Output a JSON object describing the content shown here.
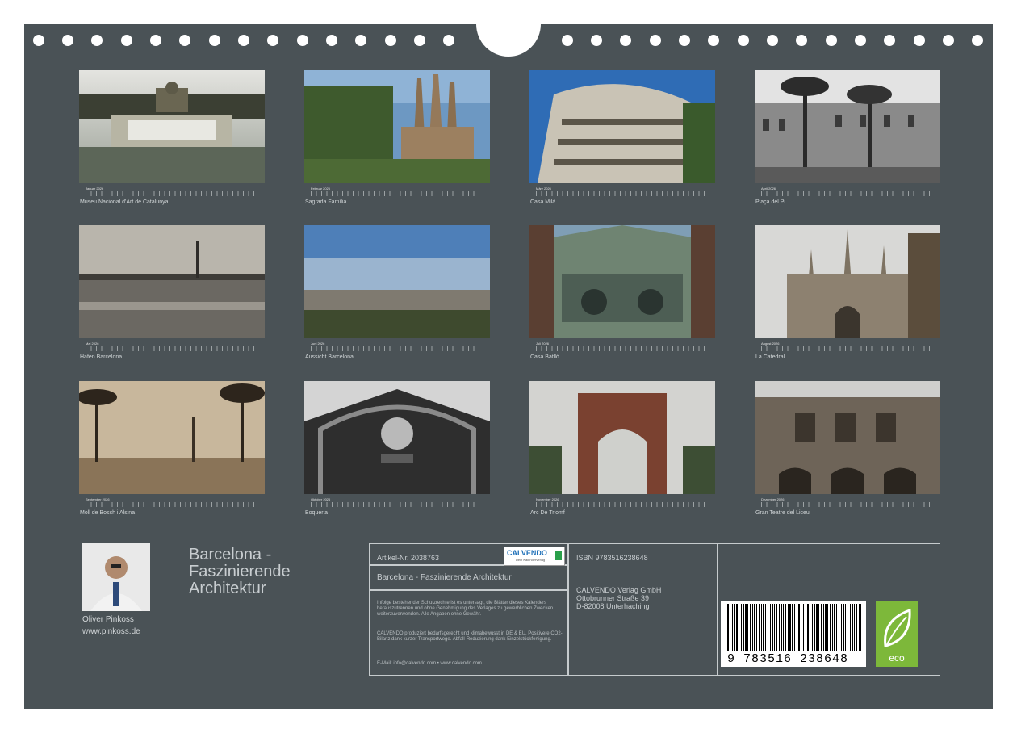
{
  "months": [
    {
      "name": "Januar 2026",
      "caption": "Museu Nacional d'Art de Catalunya"
    },
    {
      "name": "Februar 2026",
      "caption": "Sagrada Família"
    },
    {
      "name": "März 2026",
      "caption": "Casa Milà"
    },
    {
      "name": "April 2026",
      "caption": "Plaça del Pi"
    },
    {
      "name": "Mai 2026",
      "caption": "Hafen Barcelona"
    },
    {
      "name": "Juni 2026",
      "caption": "Aussicht Barcelona"
    },
    {
      "name": "Juli 2026",
      "caption": "Casa Batlló"
    },
    {
      "name": "August 2026",
      "caption": "La Catedral"
    },
    {
      "name": "September 2026",
      "caption": "Moll de Bosch i Alsina"
    },
    {
      "name": "Oktober 2026",
      "caption": "Boqueria"
    },
    {
      "name": "November 2026",
      "caption": "Arc De Triomf"
    },
    {
      "name": "Dezember 2026",
      "caption": "Gran Teatre del Liceu"
    }
  ],
  "author": {
    "name": "Oliver Pinkoss",
    "website": "www.pinkoss.de"
  },
  "title_lines": [
    "Barcelona -",
    "Faszinierende",
    "Architektur"
  ],
  "info": {
    "article": "Artikel-Nr. 2038763",
    "logo": "CALVENDO",
    "logo_sub": "Dein Kalenderverlag",
    "product_title": "Barcelona - Faszinierende Architektur",
    "legal1": "Infolge bestehender Schutzrechte ist es untersagt, die Blätter dieses Kalenders herauszutrennen und ohne Genehmigung des Verlages zu gewerblichen Zwecken weiterzuverwenden. Alle Angaben ohne Gewähr.",
    "legal2": "CALVENDO produziert bedarfsgerecht und klimabewusst in DE & EU. Positivere CO2-Bilanz dank kurzer Transportwege. Abfall-Reduzierung dank Einzelstückfertigung.",
    "email": "E-Mail: info@calvendo.com • www.calvendo.com",
    "isbn": "ISBN 9783516238648",
    "publisher": [
      "CALVENDO Verlag GmbH",
      "Ottobrunner Straße 39",
      "D-82008 Unterhaching"
    ],
    "barcode_digits": "9 783516 238648",
    "eco": "eco"
  },
  "colors": {
    "background": "#4a5256",
    "border": "#c6cbcd",
    "eco": "#7db83a"
  }
}
